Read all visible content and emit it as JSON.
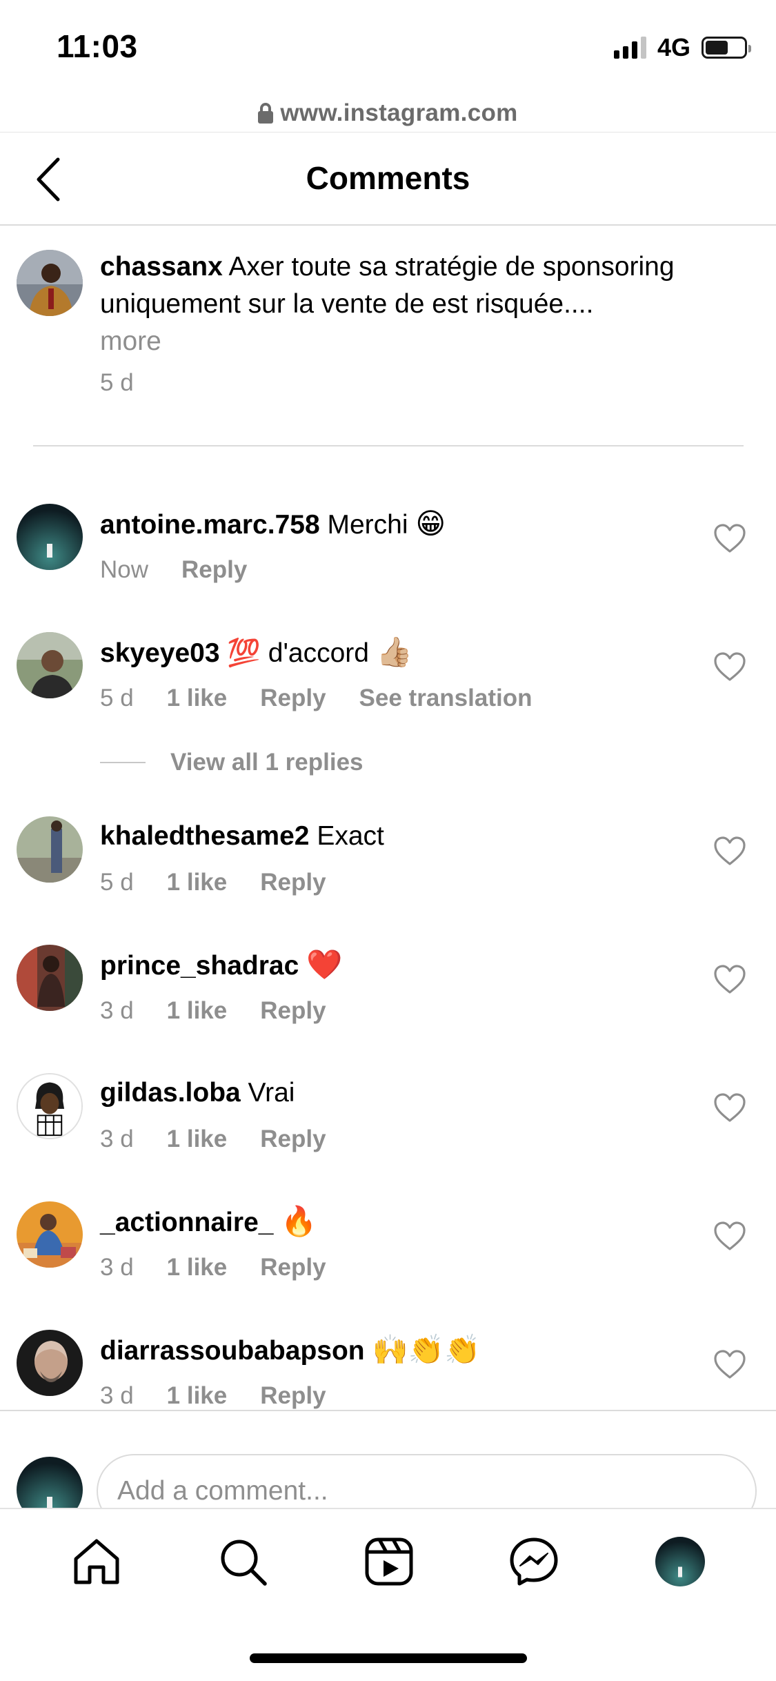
{
  "status_bar": {
    "time": "11:03",
    "network": "4G"
  },
  "browser": {
    "url": "www.instagram.com"
  },
  "header": {
    "title": "Comments",
    "back_icon": "chevron-left-icon"
  },
  "caption": {
    "username": "chassanx",
    "text": "Axer toute sa stratégie de sponsoring uniquement sur la vente de est risquée....",
    "more": "more",
    "time": "5 d"
  },
  "comments": [
    {
      "username": "antoine.marc.758",
      "text": "Merchi",
      "emoji": "😁",
      "time": "Now",
      "reply": "Reply"
    },
    {
      "username": "skyeye03",
      "text": "💯 d'accord",
      "emoji": "👍🏼",
      "time": "5 d",
      "likes": "1 like",
      "reply": "Reply",
      "translate": "See translation"
    },
    {
      "username": "khaledthesame2",
      "text": "Exact",
      "time": "5 d",
      "likes": "1 like",
      "reply": "Reply"
    },
    {
      "username": "prince_shadrac",
      "emoji": "❤️",
      "time": "3 d",
      "likes": "1 like",
      "reply": "Reply"
    },
    {
      "username": "gildas.loba",
      "text": "Vrai",
      "time": "3 d",
      "likes": "1 like",
      "reply": "Reply"
    },
    {
      "username": "_actionnaire_",
      "emoji": "🔥",
      "time": "3 d",
      "likes": "1 like",
      "reply": "Reply"
    },
    {
      "username": "diarrassoubabapson",
      "emoji": "🙌👏👏",
      "time": "3 d",
      "likes": "1 like",
      "reply": "Reply"
    }
  ],
  "view_replies": "View all 1 replies",
  "add_comment": {
    "placeholder": "Add a comment..."
  },
  "bottom_nav": [
    "home-icon",
    "search-icon",
    "reels-icon",
    "messenger-icon",
    "profile-avatar"
  ]
}
